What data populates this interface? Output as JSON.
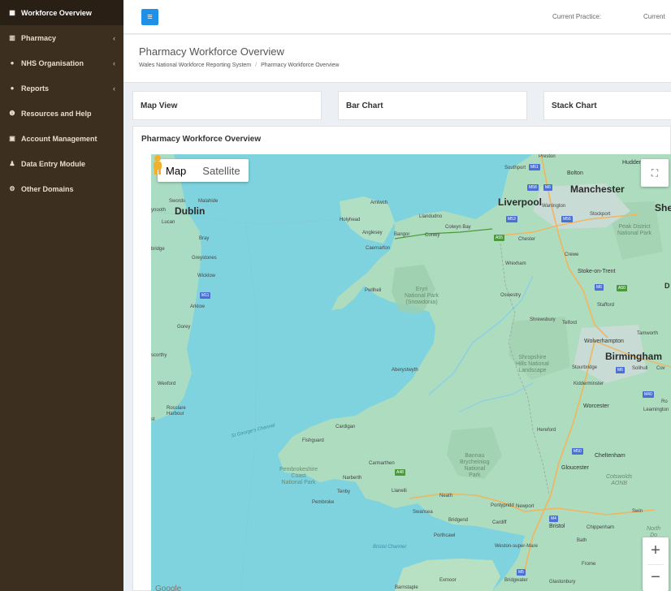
{
  "sidebar": {
    "items": [
      {
        "label": "Workforce Overview",
        "icon": "table-icon",
        "active": true
      },
      {
        "label": "Pharmacy",
        "icon": "chart-icon",
        "chevron": "‹"
      },
      {
        "label": "NHS Organisation",
        "icon": "users-icon",
        "chevron": "‹"
      },
      {
        "label": "Reports",
        "icon": "users-icon",
        "chevron": "‹"
      },
      {
        "label": "Resources and Help",
        "icon": "info-icon"
      },
      {
        "label": "Account Management",
        "icon": "table-icon"
      },
      {
        "label": "Data Entry Module",
        "icon": "user-icon"
      },
      {
        "label": "Other Domains",
        "icon": "cogs-icon"
      }
    ]
  },
  "header": {
    "current_practice_label": "Current Practice:",
    "current_truncated": "Current"
  },
  "page": {
    "title": "Pharmacy Workforce Overview",
    "breadcrumb": [
      "Wales National Workforce Reporting System",
      "Pharmacy Workforce Overview"
    ]
  },
  "tabs": [
    "Map View",
    "Bar Chart",
    "Stack Chart"
  ],
  "panel": {
    "title": "Pharmacy Workforce Overview"
  },
  "map": {
    "map_type_options": [
      "Map",
      "Satellite"
    ],
    "selected_map_type": "Map",
    "zoom_in": "+",
    "zoom_out": "−",
    "places": {
      "preston": "Preston",
      "southport": "Southport",
      "bolton": "Bolton",
      "hudder": "Hudder",
      "manchester": "Manchester",
      "liverpool": "Liverpool",
      "warrington": "Warrington",
      "stockport": "Stockport",
      "she": "She",
      "peak": "Peak District\nNational Park",
      "dublin": "Dublin",
      "swords": "Swords",
      "malahide": "Malahide",
      "ynooth": "ynooth",
      "lucan": "Lucan",
      "bray": "Bray",
      "bridge": "bridge",
      "greystones": "Greystones",
      "wicklow": "Wicklow",
      "arklow": "Arklow",
      "gorey": "Gorey",
      "scorthy": "scorthy",
      "wexford": "Wexford",
      "rosslare": "Rosslare\nHarbour",
      "amlwch": "Amlwch",
      "holyhead": "Holyhead",
      "llandudno": "Llandudno",
      "colwyn": "Colwyn Bay",
      "anglesey": "Anglesey",
      "bangor": "Bangor",
      "conwy": "Conwy",
      "caernarfon": "Caernarfon",
      "chester": "Chester",
      "wrexham": "Wrexham",
      "crewe": "Crewe",
      "stoke": "Stoke-on-Trent",
      "pwllheli": "Pwllheli",
      "eryri": "Eryri\nNational Park\n(Snowdonia)",
      "oswestry": "Oswestry",
      "stafford": "Stafford",
      "shrewsbury": "Shrewsbury",
      "telford": "Telford",
      "tamworth": "Tamworth",
      "wolverhampton": "Wolverhampton",
      "birmingham": "Birmingham",
      "aberystwyth": "Aberystwyth",
      "shropshire": "Shropshire\nHills National\nLandscape",
      "stourbridge": "Stourbridge",
      "solihull": "Solihull",
      "cov": "Cov",
      "kidderminster": "Kidderminster",
      "worcester": "Worcester",
      "leamington": "Leamington",
      "ro": "Ro",
      "stgeorge": "St George's Channel",
      "cardigan": "Cardigan",
      "hereford": "Hereford",
      "fishguard": "Fishguard",
      "carmarthen": "Carmarthen",
      "bannau": "Bannau\nBrycheiniog\nNational\nPark",
      "cheltenham": "Cheltenham",
      "gloucester": "Gloucester",
      "cotswolds": "Cotswolds\nAONB",
      "pembrokeshire": "Pembrokeshire\nCoast\nNational Park",
      "narberth": "Narberth",
      "llanelli": "Llanelli",
      "neath": "Neath",
      "tenby": "Tenby",
      "pembroke": "Pembroke",
      "pontypridd": "Pontypridd",
      "newport": "Newport",
      "swansea": "Swansea",
      "swin": "Swin",
      "bridgend": "Bridgend",
      "cardiff": "Cardiff",
      "bristol": "Bristol",
      "chippenham": "Chippenham",
      "north": "North\nDo",
      "porthcawl": "Porthcawl",
      "bristol_channel": "Bristol Channel",
      "weston": "Weston-super-Mare",
      "bath": "Bath",
      "frome": "Frome",
      "exmoor": "Exmoor",
      "barnstaple": "Barnstaple",
      "bridgwater": "Bridgwater",
      "glastonbury": "Glastonbury",
      "google": "Google",
      "d": "D",
      "st": "st"
    },
    "road_shields": {
      "m61": "M61",
      "m58": "M58",
      "m6a": "M6",
      "m62": "M62",
      "m53": "M53",
      "m56": "M56",
      "a55": "A55",
      "m6b": "M6",
      "a50": "A50",
      "m11": "M11",
      "m40": "M40",
      "m5": "M5",
      "m50": "M50",
      "m4": "M4",
      "a48": "A48",
      "m6c": "M6",
      "m6d": "M6"
    }
  }
}
